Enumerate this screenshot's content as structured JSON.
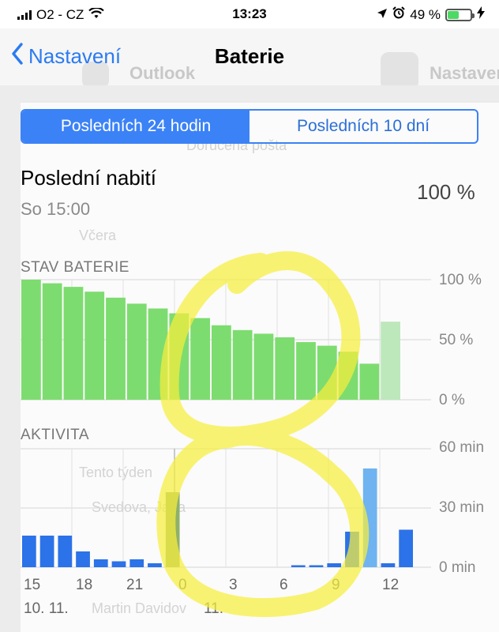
{
  "status": {
    "carrier": "O2 - CZ",
    "time": "13:23",
    "battery_pct": "49 %",
    "battery_level": 0.49
  },
  "nav": {
    "back_label": "Nastavení",
    "title": "Baterie"
  },
  "background_apps": {
    "app1": "Outlook",
    "app2": "Nastavení"
  },
  "segmented": {
    "opt1": "Posledních 24 hodin",
    "opt2": "Posledních 10 dní"
  },
  "last_charge": {
    "title": "Poslední nabití",
    "when": "So 15:00",
    "level": "100 %"
  },
  "battery_chart": {
    "label": "STAV BATERIE",
    "y_ticks": [
      "100 %",
      "50 %",
      "0 %"
    ]
  },
  "activity_chart": {
    "label": "AKTIVITA",
    "y_ticks": [
      "60 min",
      "30 min",
      "0 min"
    ],
    "x_ticks": [
      "15",
      "18",
      "21",
      "0",
      "3",
      "6",
      "9",
      "12"
    ],
    "dates": [
      "10. 11.",
      "11."
    ]
  },
  "ghost_mail": {
    "items": [
      "Doručená pošta",
      "Včera",
      "Tento týden",
      "Svedova, Jana",
      "Martin Davidov"
    ]
  },
  "chart_data": [
    {
      "type": "bar",
      "title": "STAV BATERIE",
      "ylabel": "",
      "ylim": [
        0,
        100
      ],
      "x": [
        "15",
        "18",
        "21",
        "0",
        "3",
        "6",
        "9",
        "12"
      ],
      "series": [
        {
          "name": "",
          "values": [
            100,
            97,
            94,
            90,
            85,
            80,
            76,
            72,
            68,
            62,
            58,
            55,
            52,
            48,
            45,
            40,
            30,
            65
          ]
        }
      ]
    },
    {
      "type": "bar",
      "title": "AKTIVITA",
      "ylabel": "",
      "ylim": [
        0,
        60
      ],
      "x": [
        "15",
        "18",
        "21",
        "0",
        "3",
        "6",
        "9",
        "12"
      ],
      "series": [
        {
          "name": "",
          "values": [
            16,
            16,
            16,
            8,
            4,
            3,
            4,
            2,
            38,
            0,
            0,
            0,
            0,
            0,
            0,
            1,
            1,
            2,
            18,
            50,
            2,
            19
          ]
        }
      ]
    }
  ]
}
